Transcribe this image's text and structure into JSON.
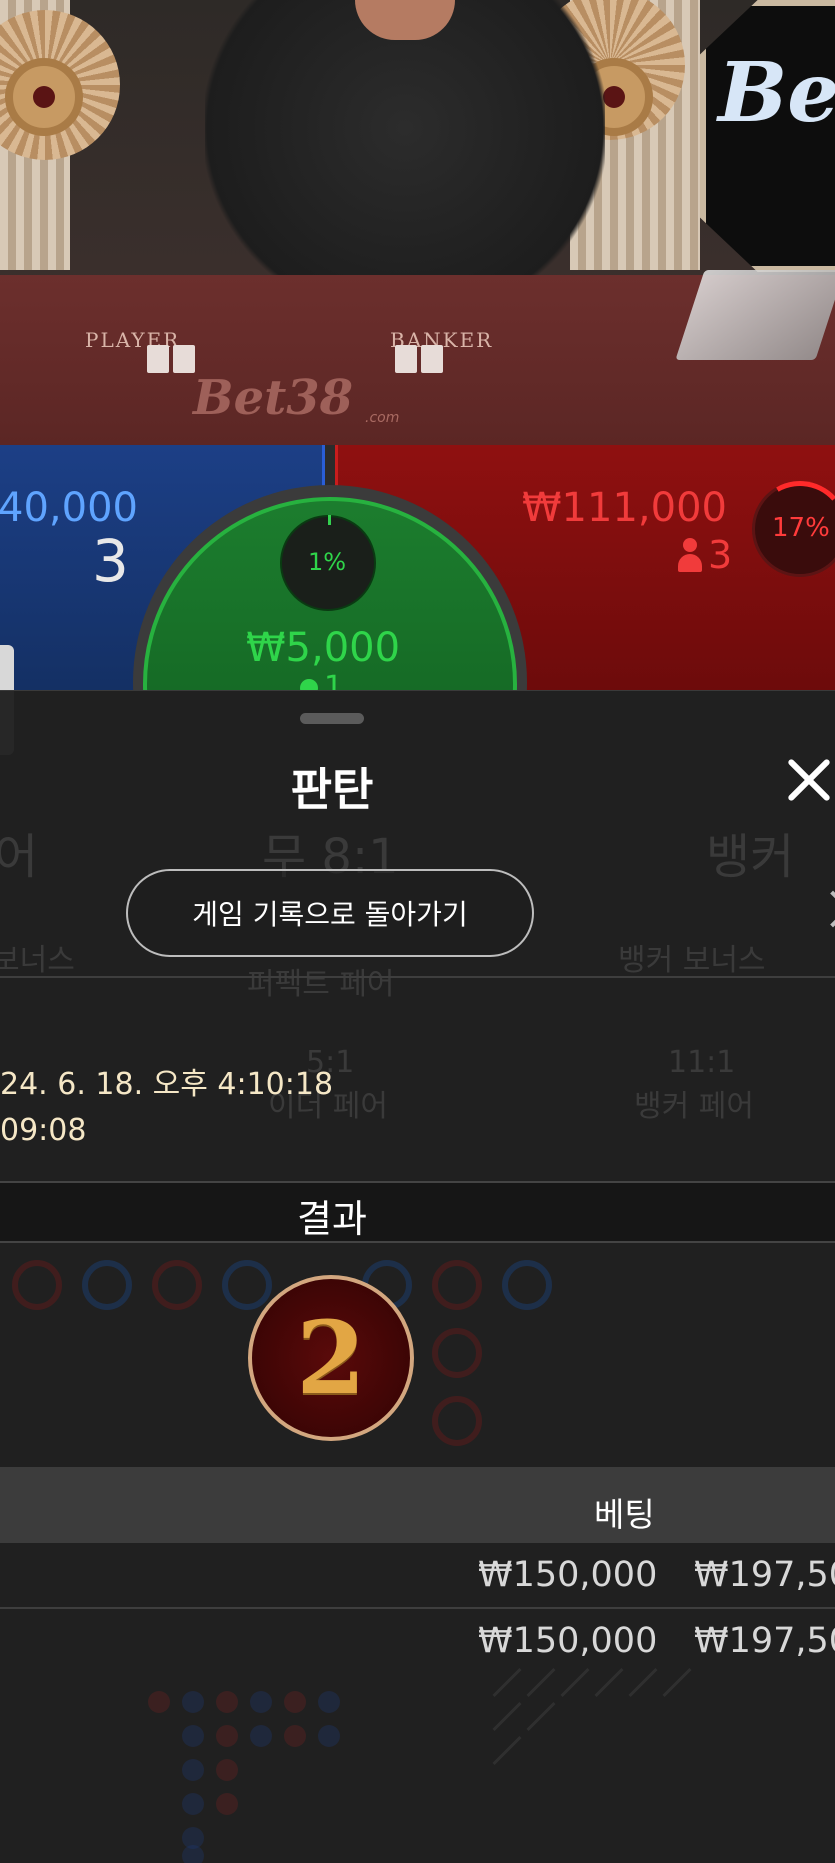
{
  "video": {
    "logo_text": "Be",
    "table_logo": "Bet38",
    "table_logo_sub": ".com",
    "player_label": "PLAYER",
    "banker_label": "BANKER"
  },
  "board": {
    "player": {
      "amount": "40,000",
      "count": "3",
      "color": "#5fa4ff"
    },
    "tie": {
      "percent": "1%",
      "amount": "₩5,000",
      "count": "1",
      "color": "#2fd54a"
    },
    "banker": {
      "amount": "₩111,000",
      "count": "3",
      "percent": "17%",
      "color": "#f13b3b"
    }
  },
  "sheet": {
    "title": "판탄",
    "back_button": "게임 기록으로 돌아가기",
    "datetime_line1": "24. 6. 18. 오후 4:10:18",
    "datetime_line2": "09:08",
    "result_label": "결과",
    "result_value": "2",
    "bet_header": "베팅",
    "bet_rows": [
      {
        "amount": "₩150,000",
        "payout": "₩197,50"
      },
      {
        "amount": "₩150,000",
        "payout": "₩197,50"
      }
    ]
  },
  "background_ghost": {
    "player_short": "어",
    "tie": "무 8:1",
    "banker": "뱅커",
    "player_bonus": "보너스",
    "perfect_pair": "퍼펙트 페어",
    "banker_bonus": "뱅커 보너스",
    "either_pair_odds": "5:1",
    "either_pair": "이더 페어",
    "banker_pair_odds": "11:1",
    "banker_pair": "뱅커 페어"
  }
}
